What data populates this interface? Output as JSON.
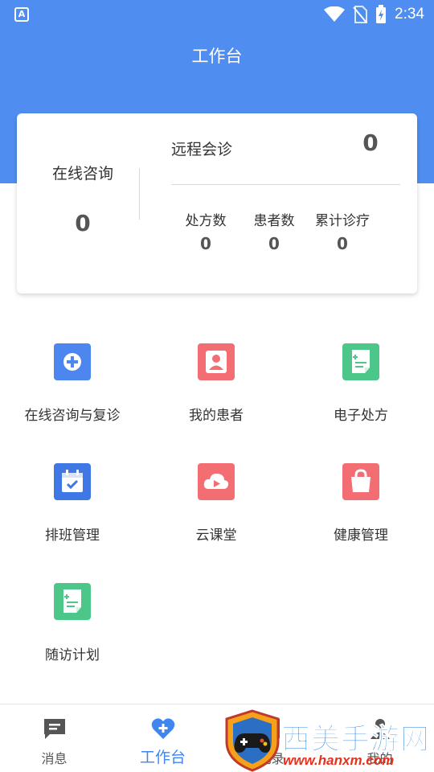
{
  "status_bar": {
    "time": "2:34"
  },
  "header": {
    "title": "工作台"
  },
  "summary_card": {
    "online_consult_label": "在线咨询",
    "online_consult_value": "0",
    "remote_consult_label": "远程会诊",
    "remote_consult_value": "0",
    "stats": [
      {
        "label": "处方数",
        "value": "0"
      },
      {
        "label": "患者数",
        "value": "0"
      },
      {
        "label": "累计诊疗",
        "value": "0"
      }
    ]
  },
  "grid": {
    "items": [
      {
        "label": "在线咨询与复诊",
        "icon": "medical-cross-icon",
        "color": "#4c86ee"
      },
      {
        "label": "我的患者",
        "icon": "patient-card-icon",
        "color": "#f26e72"
      },
      {
        "label": "电子处方",
        "icon": "prescription-icon",
        "color": "#4cc789"
      },
      {
        "label": "排班管理",
        "icon": "calendar-check-icon",
        "color": "#3f78e4"
      },
      {
        "label": "云课堂",
        "icon": "cloud-play-icon",
        "color": "#f26e72"
      },
      {
        "label": "健康管理",
        "icon": "shopping-bag-icon",
        "color": "#f26e72"
      },
      {
        "label": "随访计划",
        "icon": "followup-doc-icon",
        "color": "#4cc789"
      }
    ]
  },
  "tabbar": {
    "tabs": [
      {
        "label": "消息",
        "icon": "message-icon"
      },
      {
        "label": "工作台",
        "icon": "heart-plus-icon",
        "active": true
      },
      {
        "label": "记录",
        "icon": "record-icon"
      },
      {
        "label": "我的",
        "icon": "profile-icon"
      }
    ]
  },
  "watermark": {
    "text": "西美手游网",
    "url": "www.hanxm.com"
  },
  "colors": {
    "primary": "#4f8ef0",
    "active_tab": "#3f86f0"
  }
}
